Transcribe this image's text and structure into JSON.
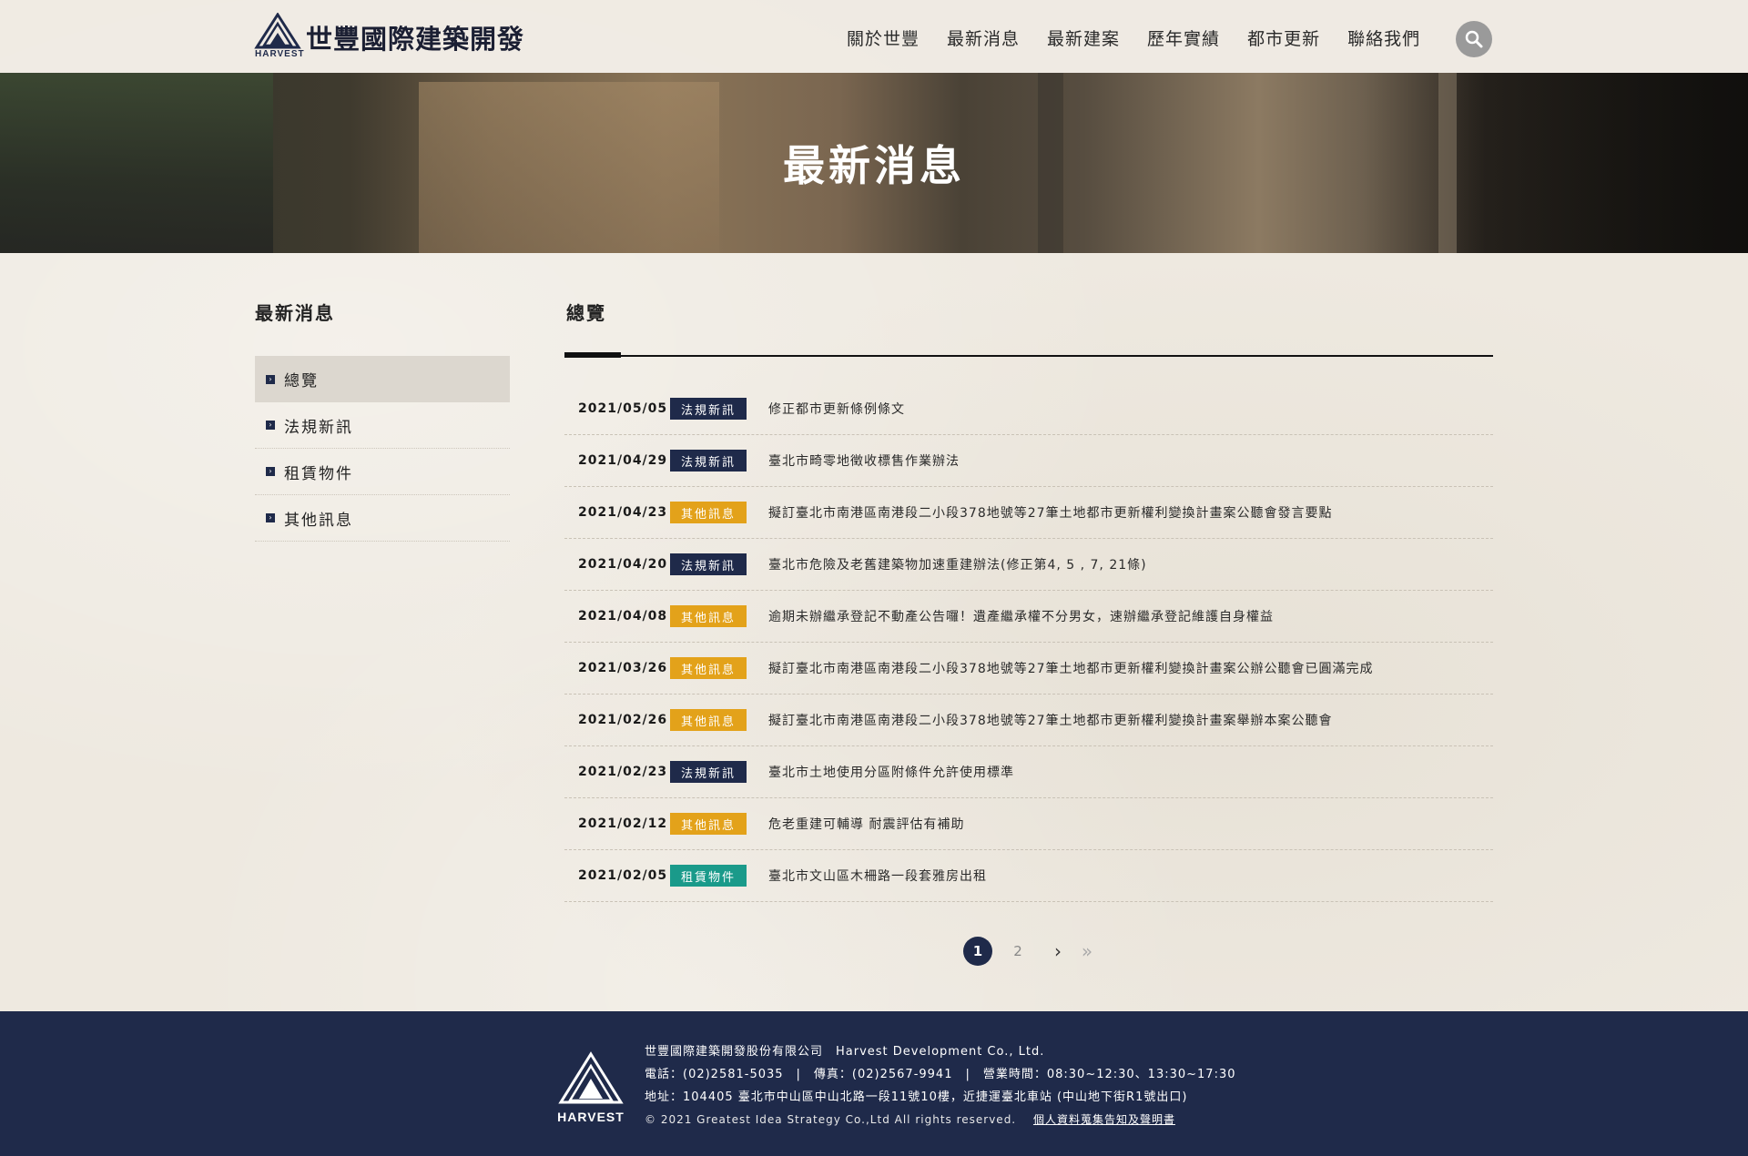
{
  "brand": {
    "name": "世豐國際建築開發",
    "en": "HARVEST"
  },
  "nav": [
    {
      "label": "關於世豐"
    },
    {
      "label": "最新消息"
    },
    {
      "label": "最新建案"
    },
    {
      "label": "歷年實績"
    },
    {
      "label": "都市更新"
    },
    {
      "label": "聯絡我們"
    }
  ],
  "banner": {
    "title": "最新消息"
  },
  "sidebar": {
    "title": "最新消息",
    "items": [
      {
        "label": "總覽",
        "active": true
      },
      {
        "label": "法規新訊"
      },
      {
        "label": "租賃物件"
      },
      {
        "label": "其他訊息"
      }
    ]
  },
  "main": {
    "title": "總覽",
    "news": [
      {
        "date": "2021/05/05",
        "tag": "法規新訊",
        "tag_color": "#1f2a4a",
        "title": "修正都市更新條例條文"
      },
      {
        "date": "2021/04/29",
        "tag": "法規新訊",
        "tag_color": "#1f2a4a",
        "title": "臺北市畸零地徵收標售作業辦法"
      },
      {
        "date": "2021/04/23",
        "tag": "其他訊息",
        "tag_color": "#e3a21a",
        "title": "擬訂臺北市南港區南港段二小段378地號等27筆土地都市更新權利變換計畫案公聽會發言要點"
      },
      {
        "date": "2021/04/20",
        "tag": "法規新訊",
        "tag_color": "#1f2a4a",
        "title": "臺北市危險及老舊建築物加速重建辦法(修正第4, 5 , 7, 21條)"
      },
      {
        "date": "2021/04/08",
        "tag": "其他訊息",
        "tag_color": "#e3a21a",
        "title": "逾期未辦繼承登記不動產公告囉！遺產繼承權不分男女，速辦繼承登記維護自身權益"
      },
      {
        "date": "2021/03/26",
        "tag": "其他訊息",
        "tag_color": "#e3a21a",
        "title": "擬訂臺北市南港區南港段二小段378地號等27筆土地都市更新權利變換計畫案公辦公聽會已圓滿完成"
      },
      {
        "date": "2021/02/26",
        "tag": "其他訊息",
        "tag_color": "#e3a21a",
        "title": "擬訂臺北市南港區南港段二小段378地號等27筆土地都市更新權利變換計畫案舉辦本案公聽會"
      },
      {
        "date": "2021/02/23",
        "tag": "法規新訊",
        "tag_color": "#1f2a4a",
        "title": "臺北市土地使用分區附條件允許使用標準"
      },
      {
        "date": "2021/02/12",
        "tag": "其他訊息",
        "tag_color": "#e3a21a",
        "title": "危老重建可輔導 耐震評估有補助"
      },
      {
        "date": "2021/02/05",
        "tag": "租賃物件",
        "tag_color": "#1a9a8a",
        "title": "臺北市文山區木柵路一段套雅房出租"
      }
    ]
  },
  "pagination": {
    "pages": [
      "1",
      "2"
    ],
    "current": "1",
    "next": "›",
    "last": "»"
  },
  "footer": {
    "logo_text": "HARVEST",
    "company": "世豐國際建築開發股份有限公司　Harvest Development Co., Ltd.",
    "contact": "電話：(02)2581-5035　|　傳真：(02)2567-9941　|　營業時間：08:30~12:30、13:30~17:30",
    "address": "地址：104405 臺北市中山區中山北路一段11號10樓，近捷運臺北車站 (中山地下街R1號出口)",
    "copyright": "© 2021 Greatest Idea Strategy Co.,Ltd All rights reserved.",
    "privacy": "個人資料蒐集告知及聲明書"
  },
  "colors": {
    "navy": "#1f2a4a",
    "orange": "#e3a21a",
    "teal": "#1a9a8a"
  }
}
